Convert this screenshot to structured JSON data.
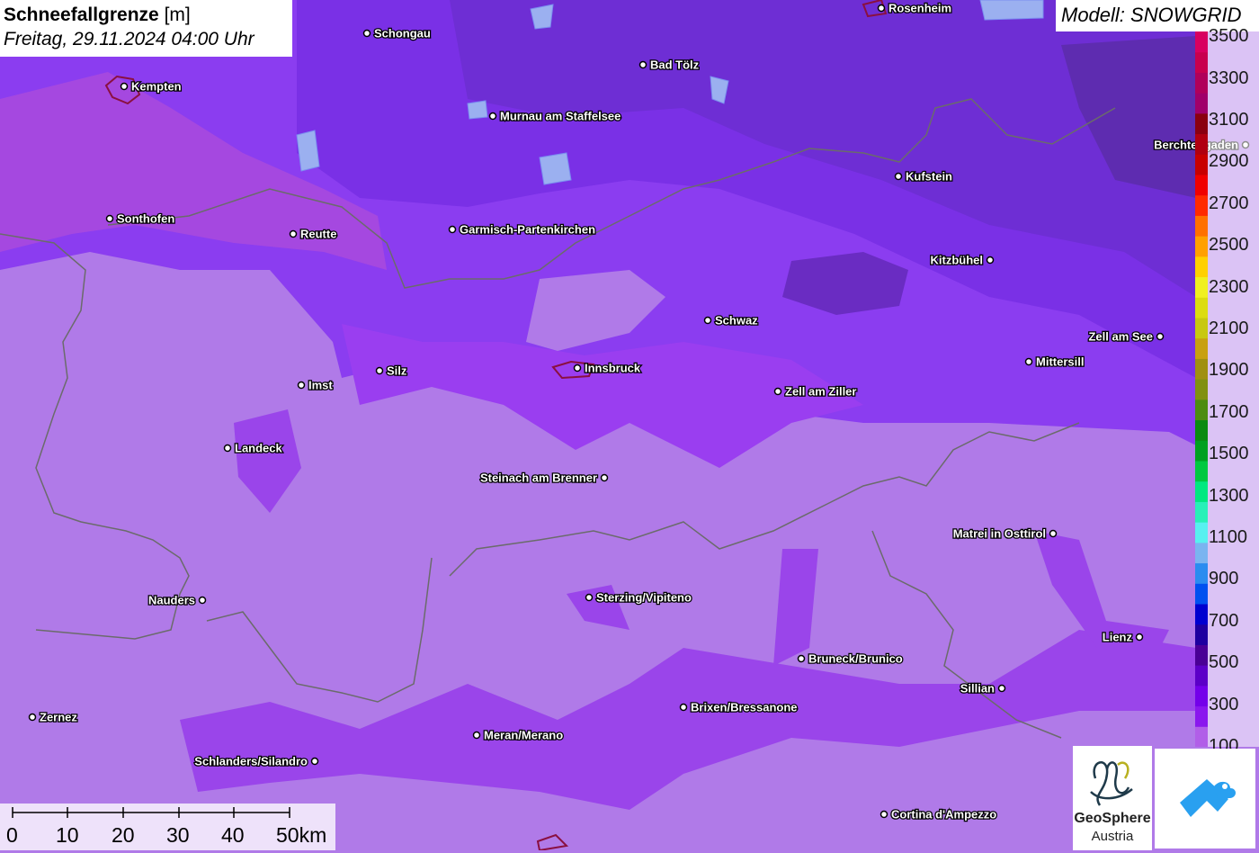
{
  "title": {
    "bold": "Schneefallgrenze",
    "unit": "[m]",
    "datetime": "Freitag, 29.11.2024 04:00 Uhr"
  },
  "model": "Modell: SNOWGRID",
  "legend": {
    "labels": [
      "100",
      "300",
      "500",
      "700",
      "900",
      "1100",
      "1300",
      "1500",
      "1700",
      "1900",
      "2100",
      "2300",
      "2500",
      "2700",
      "2900",
      "3100",
      "3300",
      "3500"
    ],
    "colors": [
      "#b15ee8",
      "#8a17ee",
      "#7400ea",
      "#5c00c8",
      "#4a0096",
      "#1e00a0",
      "#0000d0",
      "#0050f0",
      "#2a8cf0",
      "#7ab4f0",
      "#58f0f0",
      "#28f0b8",
      "#00e880",
      "#00c840",
      "#00a020",
      "#0a8a10",
      "#4c8c10",
      "#809010",
      "#a09010",
      "#c8a010",
      "#c8c810",
      "#dcdc10",
      "#f0f020",
      "#ffd000",
      "#ffa000",
      "#ff7000",
      "#ff2a00",
      "#f00000",
      "#c80000",
      "#b00010",
      "#8a0010",
      "#a0006a",
      "#b0005a",
      "#c8004e",
      "#d80060"
    ]
  },
  "places": [
    {
      "name": "Rosenheim"
    },
    {
      "name": "Schongau"
    },
    {
      "name": "Kempten"
    },
    {
      "name": "Bad Tölz"
    },
    {
      "name": "Murnau am Staffelsee"
    },
    {
      "name": "Berchtesgaden"
    },
    {
      "name": "Kufstein"
    },
    {
      "name": "Sonthofen"
    },
    {
      "name": "Reutte"
    },
    {
      "name": "Garmisch-Partenkirchen"
    },
    {
      "name": "Kitzbühel"
    },
    {
      "name": "Schwaz"
    },
    {
      "name": "Zell am See"
    },
    {
      "name": "Mittersill"
    },
    {
      "name": "Silz"
    },
    {
      "name": "Innsbruck"
    },
    {
      "name": "Imst"
    },
    {
      "name": "Zell am Ziller"
    },
    {
      "name": "Landeck"
    },
    {
      "name": "Steinach am Brenner"
    },
    {
      "name": "Matrei in Osttirol"
    },
    {
      "name": "Nauders"
    },
    {
      "name": "Sterzing/Vipiteno"
    },
    {
      "name": "Lienz"
    },
    {
      "name": "Bruneck/Brunico"
    },
    {
      "name": "Sillian"
    },
    {
      "name": "Brixen/Bressanone"
    },
    {
      "name": "Zernez"
    },
    {
      "name": "Meran/Merano"
    },
    {
      "name": "Schlanders/Silandro"
    },
    {
      "name": "Cortina d'Ampezzo"
    }
  ],
  "scale": {
    "labels": [
      "0",
      "10",
      "20",
      "30",
      "40",
      "50km"
    ]
  },
  "logos": {
    "geosphere_name": "GeoSphere",
    "geosphere_sub": "Austria"
  },
  "colors": {
    "base": "#b07ae8",
    "mid": "#9a4cf0",
    "dark": "#7a2ee6",
    "darker": "#6a2ccc",
    "darkest": "#5a2aa8",
    "pink": "#c255d8"
  }
}
